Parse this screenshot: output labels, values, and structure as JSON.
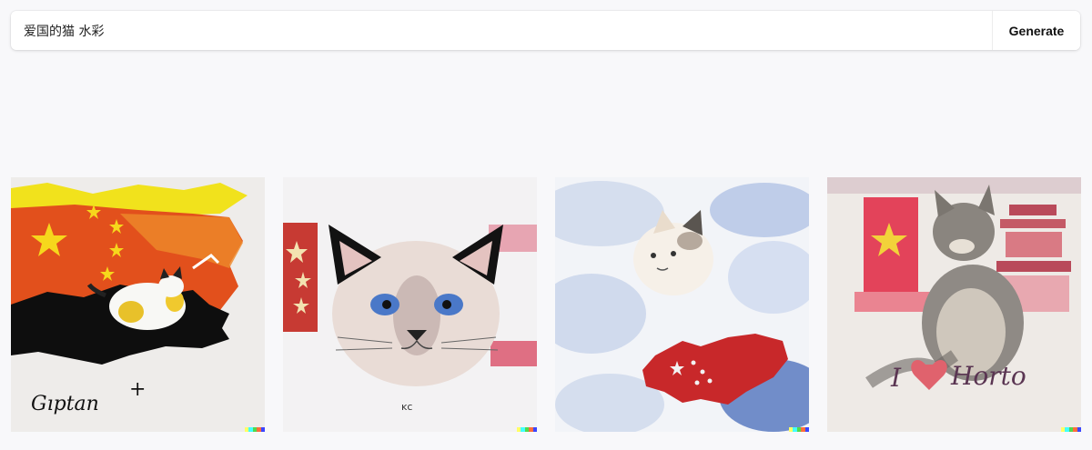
{
  "prompt": {
    "value": "爱国的猫 水彩",
    "generate_label": "Generate"
  },
  "gallery": {
    "images": [
      {
        "caption": "Gıptan",
        "caption_extra": "+"
      },
      {
        "caption": "ᴋᴄ"
      },
      {
        "caption": ""
      },
      {
        "caption_left": "I",
        "caption_right": "Horto"
      }
    ],
    "signature_colors": [
      "#ffff66",
      "#42ffff",
      "#51da4c",
      "#ff6e3c",
      "#3c46ff"
    ]
  }
}
